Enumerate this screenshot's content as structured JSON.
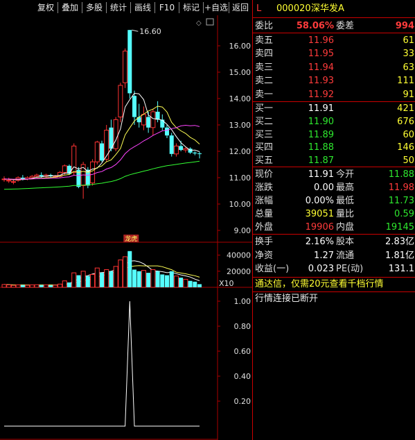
{
  "toolbar": {
    "buttons": [
      "复权",
      "叠加",
      "多股",
      "统计",
      "画线",
      "F10",
      "标记",
      "+自选",
      "返回"
    ]
  },
  "chart": {
    "price_ticks": [
      "16.00",
      "15.00",
      "14.00",
      "13.00",
      "12.00",
      "11.00",
      "10.00",
      "9.00"
    ],
    "peak_label": "16.60",
    "event_tag": "龙虎",
    "volume_ticks": [
      "40000",
      "20000"
    ],
    "volume_unit": "X10",
    "indicator_ticks": [
      "1.00",
      "0.80",
      "0.60",
      "0.40",
      "0.20"
    ],
    "colors": {
      "up": "#ff3333",
      "down": "#55ffff",
      "ma5": "#ffffff",
      "ma10": "#ffff55",
      "ma20": "#ff44ff",
      "ma60": "#33ff33",
      "grid": "#aa0000"
    }
  },
  "chart_data": {
    "type": "candlestick",
    "price_range": [
      9.0,
      16.6
    ],
    "candles": [
      {
        "o": 10.95,
        "h": 11.05,
        "l": 10.85,
        "c": 10.95
      },
      {
        "o": 10.9,
        "h": 11.0,
        "l": 10.8,
        "c": 10.9
      },
      {
        "o": 10.85,
        "h": 10.95,
        "l": 10.75,
        "c": 10.85
      },
      {
        "o": 10.9,
        "h": 11.05,
        "l": 10.85,
        "c": 11.0
      },
      {
        "o": 11.0,
        "h": 11.1,
        "l": 10.9,
        "c": 10.95
      },
      {
        "o": 10.95,
        "h": 11.05,
        "l": 10.9,
        "c": 11.0
      },
      {
        "o": 11.0,
        "h": 11.1,
        "l": 10.95,
        "c": 11.05
      },
      {
        "o": 11.05,
        "h": 11.15,
        "l": 11.0,
        "c": 11.1
      },
      {
        "o": 11.1,
        "h": 11.2,
        "l": 11.0,
        "c": 11.05
      },
      {
        "o": 11.05,
        "h": 11.15,
        "l": 11.0,
        "c": 11.1
      },
      {
        "o": 11.1,
        "h": 11.15,
        "l": 11.0,
        "c": 11.05
      },
      {
        "o": 11.05,
        "h": 11.1,
        "l": 11.0,
        "c": 11.05
      },
      {
        "o": 11.05,
        "h": 11.25,
        "l": 11.0,
        "c": 11.2
      },
      {
        "o": 11.2,
        "h": 11.5,
        "l": 11.1,
        "c": 11.45
      },
      {
        "o": 11.45,
        "h": 11.5,
        "l": 11.1,
        "c": 11.15
      },
      {
        "o": 11.2,
        "h": 12.3,
        "l": 11.1,
        "c": 12.2
      },
      {
        "o": 11.3,
        "h": 11.4,
        "l": 10.6,
        "c": 10.65
      },
      {
        "o": 10.7,
        "h": 11.6,
        "l": 10.2,
        "c": 11.5
      },
      {
        "o": 11.3,
        "h": 11.4,
        "l": 10.6,
        "c": 10.7
      },
      {
        "o": 10.8,
        "h": 11.7,
        "l": 10.7,
        "c": 11.6
      },
      {
        "o": 11.6,
        "h": 12.4,
        "l": 11.5,
        "c": 12.35
      },
      {
        "o": 12.3,
        "h": 12.4,
        "l": 11.6,
        "c": 11.65
      },
      {
        "o": 11.7,
        "h": 13.0,
        "l": 11.6,
        "c": 12.8
      },
      {
        "o": 12.9,
        "h": 13.2,
        "l": 12.0,
        "c": 12.1
      },
      {
        "o": 12.1,
        "h": 13.3,
        "l": 12.0,
        "c": 13.2
      },
      {
        "o": 13.3,
        "h": 14.6,
        "l": 13.1,
        "c": 14.5
      },
      {
        "o": 14.6,
        "h": 15.9,
        "l": 14.4,
        "c": 15.8
      },
      {
        "o": 16.6,
        "h": 16.6,
        "l": 14.0,
        "c": 14.2
      },
      {
        "o": 14.1,
        "h": 14.3,
        "l": 13.0,
        "c": 13.3
      },
      {
        "o": 13.3,
        "h": 13.8,
        "l": 12.9,
        "c": 13.1
      },
      {
        "o": 13.0,
        "h": 13.7,
        "l": 12.8,
        "c": 13.4
      },
      {
        "o": 13.3,
        "h": 13.5,
        "l": 12.7,
        "c": 12.9
      },
      {
        "o": 12.9,
        "h": 13.6,
        "l": 12.6,
        "c": 13.5
      },
      {
        "o": 13.5,
        "h": 13.9,
        "l": 13.1,
        "c": 13.2
      },
      {
        "o": 13.2,
        "h": 13.4,
        "l": 12.8,
        "c": 12.9
      },
      {
        "o": 12.9,
        "h": 13.0,
        "l": 12.5,
        "c": 12.6
      },
      {
        "o": 12.6,
        "h": 12.7,
        "l": 11.8,
        "c": 11.9
      },
      {
        "o": 11.9,
        "h": 12.3,
        "l": 11.8,
        "c": 12.2
      },
      {
        "o": 12.2,
        "h": 12.4,
        "l": 12.0,
        "c": 12.05
      },
      {
        "o": 12.05,
        "h": 12.15,
        "l": 11.95,
        "c": 12.1
      },
      {
        "o": 12.1,
        "h": 12.15,
        "l": 11.9,
        "c": 11.95
      },
      {
        "o": 11.95,
        "h": 12.0,
        "l": 11.85,
        "c": 11.92
      },
      {
        "o": 11.92,
        "h": 11.98,
        "l": 11.73,
        "c": 11.91
      }
    ],
    "volumes": [
      3500,
      3000,
      2500,
      3000,
      2800,
      2600,
      3000,
      3200,
      2800,
      3000,
      2500,
      2700,
      4000,
      8000,
      6000,
      18000,
      15000,
      20000,
      14000,
      16000,
      24000,
      18000,
      22000,
      20000,
      26000,
      34000,
      38000,
      45000,
      22000,
      20000,
      21000,
      18000,
      22000,
      20000,
      16000,
      15000,
      20000,
      14000,
      12000,
      10000,
      8000,
      7000,
      3905
    ],
    "indicator": [
      0,
      0,
      0,
      0,
      0,
      0,
      0,
      0,
      0,
      0,
      0,
      0,
      0,
      0,
      0,
      0,
      0,
      0,
      0,
      0,
      0,
      0,
      0,
      0,
      0,
      0,
      0,
      1,
      0,
      0,
      0,
      0,
      0,
      0,
      0,
      0,
      0,
      0,
      0,
      0,
      0,
      0,
      0
    ],
    "y_volume_range": [
      0,
      50000
    ],
    "y_indicator_range": [
      0,
      1.05
    ]
  },
  "quote": {
    "market": "L",
    "code": "000020",
    "name": "深华发A",
    "weibi_label": "委比",
    "weibi_value": "58.06%",
    "weicha_label": "委差",
    "weicha_value": "994",
    "asks": [
      {
        "label": "卖五",
        "price": "11.96",
        "vol": "61"
      },
      {
        "label": "卖四",
        "price": "11.95",
        "vol": "33"
      },
      {
        "label": "卖三",
        "price": "11.94",
        "vol": "63"
      },
      {
        "label": "卖二",
        "price": "11.93",
        "vol": "111"
      },
      {
        "label": "卖一",
        "price": "11.92",
        "vol": "91"
      }
    ],
    "bids": [
      {
        "label": "买一",
        "price": "11.91",
        "vol": "421"
      },
      {
        "label": "买二",
        "price": "11.90",
        "vol": "676"
      },
      {
        "label": "买三",
        "price": "11.89",
        "vol": "60"
      },
      {
        "label": "买四",
        "price": "11.88",
        "vol": "146"
      },
      {
        "label": "买五",
        "price": "11.87",
        "vol": "50"
      }
    ],
    "stats": [
      {
        "l1": "现价",
        "v1": "11.91",
        "c1": "white",
        "l2": "今开",
        "v2": "11.88",
        "c2": "green"
      },
      {
        "l1": "涨跌",
        "v1": "0.00",
        "c1": "white",
        "l2": "最高",
        "v2": "11.98",
        "c2": "red"
      },
      {
        "l1": "涨幅",
        "v1": "0.00%",
        "c1": "white",
        "l2": "最低",
        "v2": "11.73",
        "c2": "green"
      },
      {
        "l1": "总量",
        "v1": "39051",
        "c1": "yellow",
        "l2": "量比",
        "v2": "0.59",
        "c2": "green"
      },
      {
        "l1": "外盘",
        "v1": "19906",
        "c1": "red",
        "l2": "内盘",
        "v2": "19145",
        "c2": "green"
      }
    ],
    "fin": [
      {
        "l1": "换手",
        "v1": "2.16%",
        "l2": "股本",
        "v2": "2.83亿"
      },
      {
        "l1": "净资",
        "v1": "1.27",
        "l2": "流通",
        "v2": "1.81亿"
      },
      {
        "l1": "收益(一)",
        "v1": "0.023",
        "l2": "PE(动)",
        "v2": "131.1"
      }
    ],
    "promo": "通达信，仅需20元查看千档行情",
    "status": "行情连接已断开"
  }
}
